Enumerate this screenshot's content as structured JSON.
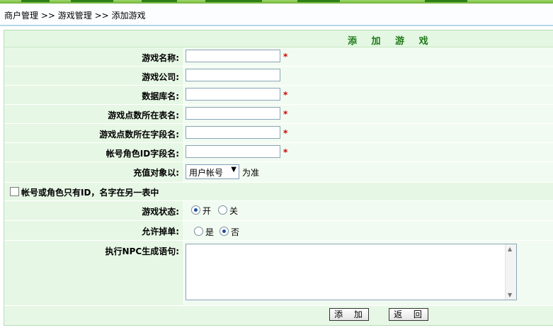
{
  "breadcrumb": {
    "items": [
      "商户管理",
      "游戏管理",
      "添加游戏"
    ],
    "separator": ">>"
  },
  "form": {
    "title": "添 加 游 戏",
    "required_mark": "*",
    "fields": {
      "game_name": {
        "label": "游戏名称:",
        "value": "",
        "required": true
      },
      "game_company": {
        "label": "游戏公司:",
        "value": "",
        "required": false
      },
      "db_name": {
        "label": "数据库名:",
        "value": "",
        "required": true
      },
      "points_table": {
        "label": "游戏点数所在表名:",
        "value": "",
        "required": true
      },
      "points_field": {
        "label": "游戏点数所在字段名:",
        "value": "",
        "required": true
      },
      "role_id_field": {
        "label": "帐号角色ID字段名:",
        "value": "",
        "required": true
      }
    },
    "recharge_target": {
      "label": "充值对象以:",
      "selected": "用户帐号",
      "suffix": "为准"
    },
    "id_only_checkbox": {
      "label": "帐号或角色只有ID，名字在另一表中",
      "checked": false
    },
    "game_status": {
      "label": "游戏状态:",
      "options": [
        "开",
        "关"
      ],
      "selected": "开"
    },
    "allow_drop": {
      "label": "允许掉单:",
      "options": [
        "是",
        "否"
      ],
      "selected": "否"
    },
    "npc_statement": {
      "label": "执行NPC生成语句:",
      "value": ""
    },
    "buttons": {
      "add": "添 加",
      "back": "返 回"
    }
  },
  "colors": {
    "header_text": "#1f7a19",
    "required": "#d00000",
    "label_bg": "#e7f7e5",
    "value_bg": "#f2fbf1"
  }
}
